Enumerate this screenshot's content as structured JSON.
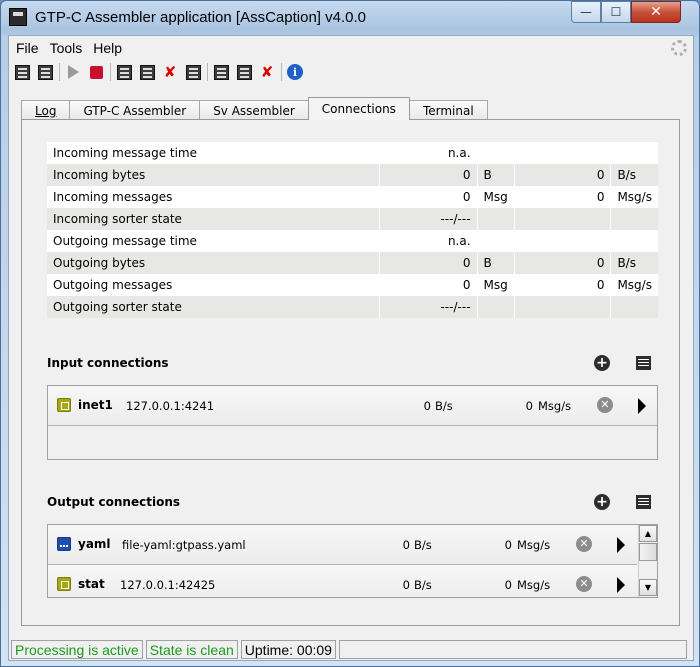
{
  "window": {
    "title": "GTP-C Assembler application [AssCaption] v4.0.0",
    "min_glyph": "—",
    "max_glyph": "☐",
    "close_glyph": "✕"
  },
  "menu": [
    "File",
    "Tools",
    "Help"
  ],
  "toolbar": {
    "icons": [
      "list-up-icon",
      "list-down-icon",
      "play-icon",
      "stop-icon",
      "save-icon",
      "save-down-icon",
      "save-remove-icon",
      "save-alt-icon",
      "config-icon",
      "config-check-icon",
      "config-remove-icon",
      "info-icon"
    ]
  },
  "tabs": [
    {
      "label": "Log",
      "active": false
    },
    {
      "label": "GTP-C Assembler",
      "active": false
    },
    {
      "label": "Sv Assembler",
      "active": false
    },
    {
      "label": "Connections",
      "active": true
    },
    {
      "label": "Terminal",
      "active": false
    }
  ],
  "stats": [
    {
      "label": "Incoming message time",
      "value": "n.a.",
      "unit": "",
      "value2": "",
      "unit2": ""
    },
    {
      "label": "Incoming bytes",
      "value": "0",
      "unit": "B",
      "value2": "0",
      "unit2": "B/s"
    },
    {
      "label": "Incoming messages",
      "value": "0",
      "unit": "Msg",
      "value2": "0",
      "unit2": "Msg/s"
    },
    {
      "label": "Incoming sorter state",
      "value": "---/---",
      "unit": "",
      "value2": "",
      "unit2": ""
    },
    {
      "label": "Outgoing message time",
      "value": "n.a.",
      "unit": "",
      "value2": "",
      "unit2": ""
    },
    {
      "label": "Outgoing bytes",
      "value": "0",
      "unit": "B",
      "value2": "0",
      "unit2": "B/s"
    },
    {
      "label": "Outgoing messages",
      "value": "0",
      "unit": "Msg",
      "value2": "0",
      "unit2": "Msg/s"
    },
    {
      "label": "Outgoing sorter state",
      "value": "---/---",
      "unit": "",
      "value2": "",
      "unit2": ""
    }
  ],
  "input": {
    "title": "Input connections",
    "connections": [
      {
        "name": "inet1",
        "address": "127.0.0.1:4241",
        "bytes_rate": "0",
        "bytes_unit": "B/s",
        "msg_rate": "0",
        "msg_unit": "Msg/s",
        "icon": "network-icon"
      }
    ]
  },
  "output": {
    "title": "Output connections",
    "connections": [
      {
        "name": "yaml",
        "address": "file-yaml:gtpass.yaml",
        "bytes_rate": "0",
        "bytes_unit": "B/s",
        "msg_rate": "0",
        "msg_unit": "Msg/s",
        "icon": "file-icon"
      },
      {
        "name": "stat",
        "address": "127.0.0.1:42425",
        "bytes_rate": "0",
        "bytes_unit": "B/s",
        "msg_rate": "0",
        "msg_unit": "Msg/s",
        "icon": "network-icon"
      }
    ]
  },
  "status": {
    "processing": "Processing is active",
    "state": "State is clean",
    "uptime": "Uptime: 00:09"
  },
  "colors": {
    "status_green": "#1e9a1e",
    "stop_red": "#c8102e",
    "info_blue": "#1f5fc9",
    "network_icon": "#a7a815",
    "file_icon": "#1f4fa8"
  }
}
